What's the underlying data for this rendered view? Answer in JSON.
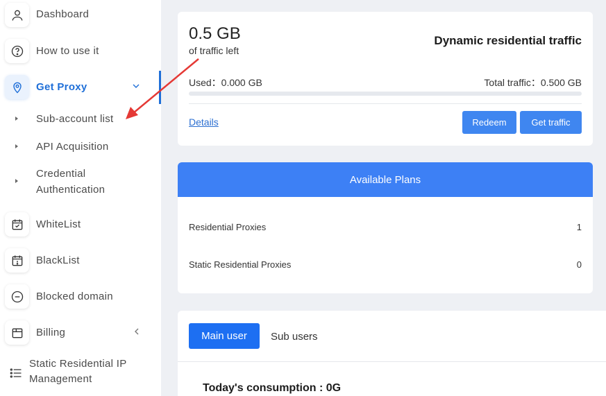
{
  "sidebar": {
    "items": [
      {
        "label": "Dashboard",
        "icon": "user-icon"
      },
      {
        "label": "How to use it",
        "icon": "help-circle-icon"
      },
      {
        "label": "Get Proxy",
        "icon": "location-pin-icon",
        "active": true
      },
      {
        "label": "WhiteList",
        "icon": "calendar-check-icon"
      },
      {
        "label": "BlackList",
        "icon": "calendar-alert-icon"
      },
      {
        "label": "Blocked domain",
        "icon": "minus-circle-icon"
      },
      {
        "label": "Billing",
        "icon": "box-icon"
      },
      {
        "label": "Static Residential IP Management",
        "icon": "list-icon"
      }
    ],
    "sub_items": [
      {
        "label": "Sub-account list"
      },
      {
        "label": "API Acquisition"
      },
      {
        "label": "Credential Authentication"
      }
    ],
    "accent_color": "#1f6fd8"
  },
  "traffic": {
    "amount": "0.5 GB",
    "amount_caption": "of traffic left",
    "title": "Dynamic residential traffic",
    "used_text": "Used：0.000 GB",
    "total_text": "Total traffic：0.500 GB",
    "used_fraction": 0,
    "details_label": "Details",
    "redeem_label": "Redeem",
    "get_traffic_label": "Get traffic"
  },
  "plans": {
    "header": "Available Plans",
    "rows": [
      {
        "name": "Residential Proxies",
        "count": "1"
      },
      {
        "name": "Static Residential Proxies",
        "count": "0"
      }
    ],
    "header_color": "#3d80f5"
  },
  "users": {
    "main_tab": "Main user",
    "sub_tab": "Sub users",
    "consumption": "Today's consumption : 0G"
  },
  "annotation": {
    "arrow_color": "#e53935"
  }
}
